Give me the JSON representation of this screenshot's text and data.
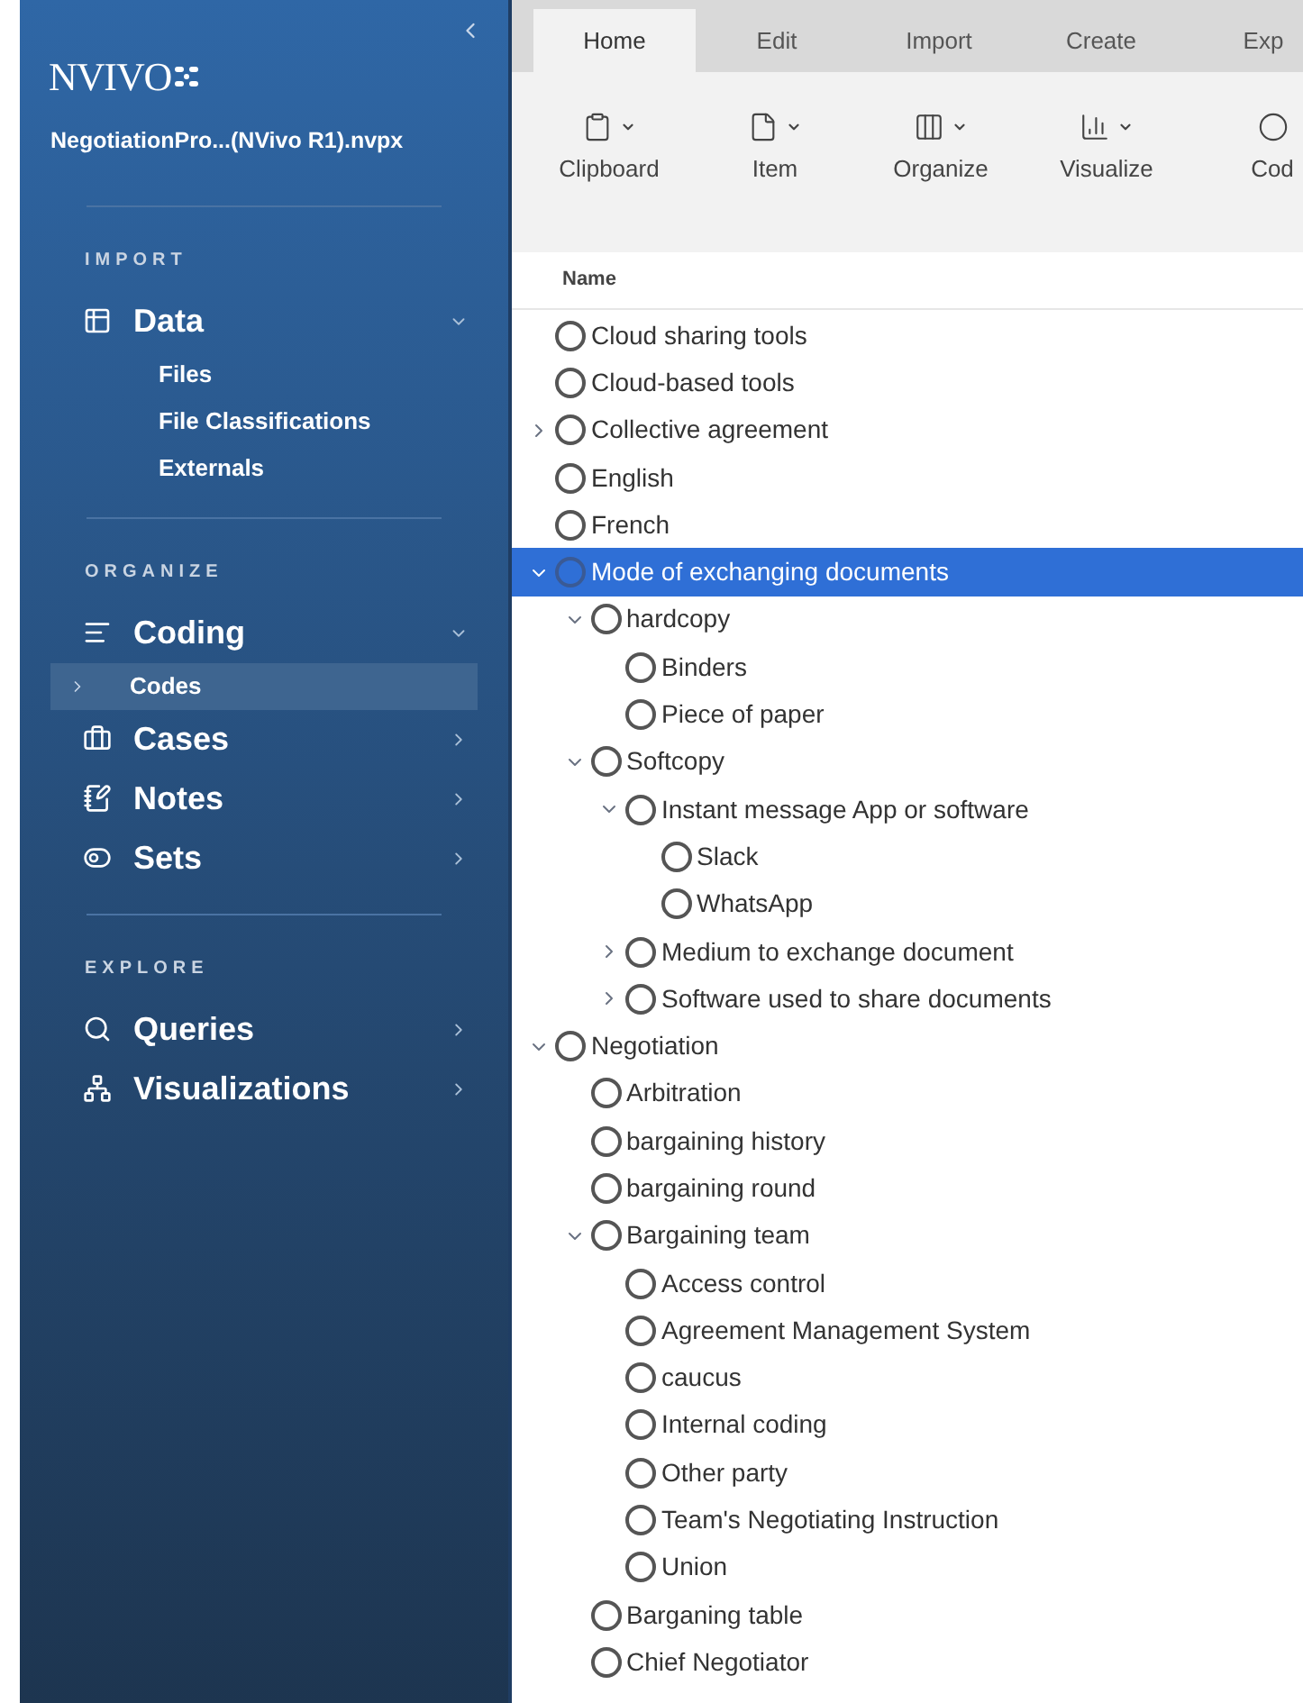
{
  "sidebar": {
    "logo": "NVIVO",
    "project": "NegotiationPro...(NVivo R1).nvpx",
    "sections": [
      {
        "title": "IMPORT",
        "items": [
          {
            "kind": "table",
            "label": "Data",
            "expanded": true,
            "children": [
              {
                "label": "Files",
                "selected": false
              },
              {
                "label": "File Classifications",
                "selected": false
              },
              {
                "label": "Externals",
                "selected": false
              }
            ]
          }
        ]
      },
      {
        "title": "ORGANIZE",
        "items": [
          {
            "kind": "lines",
            "label": "Coding",
            "expanded": true,
            "children": [
              {
                "label": "Codes",
                "selected": true
              }
            ]
          },
          {
            "kind": "briefcase",
            "label": "Cases",
            "expanded": false
          },
          {
            "kind": "notebook",
            "label": "Notes",
            "expanded": false
          },
          {
            "kind": "toggle",
            "label": "Sets",
            "expanded": false
          }
        ]
      },
      {
        "title": "EXPLORE",
        "items": [
          {
            "kind": "search",
            "label": "Queries",
            "expanded": false
          },
          {
            "kind": "network",
            "label": "Visualizations",
            "expanded": false
          }
        ]
      }
    ]
  },
  "ribbon": {
    "tabs": [
      {
        "label": "Home",
        "selected": true
      },
      {
        "label": "Edit",
        "selected": false
      },
      {
        "label": "Import",
        "selected": false
      },
      {
        "label": "Create",
        "selected": false
      },
      {
        "label": "Exp",
        "selected": false
      }
    ],
    "buttons": [
      {
        "kind": "clipboard",
        "label": "Clipboard"
      },
      {
        "kind": "document",
        "label": "Item"
      },
      {
        "kind": "organize",
        "label": "Organize"
      },
      {
        "kind": "chart",
        "label": "Visualize"
      },
      {
        "kind": "circle",
        "label": "Cod"
      }
    ]
  },
  "table": {
    "column": "Name",
    "rows": [
      {
        "label": "Cloud sharing tools",
        "selected": false
      },
      {
        "label": "Cloud-based tools",
        "selected": false
      },
      {
        "label": "Collective agreement",
        "selected": false,
        "expanded": false
      },
      {
        "label": "English",
        "selected": false
      },
      {
        "label": "French",
        "selected": false
      },
      {
        "label": "Mode of exchanging documents",
        "selected": true,
        "expanded": true,
        "children": [
          {
            "label": "hardcopy",
            "selected": false,
            "expanded": true,
            "children": [
              {
                "label": "Binders",
                "selected": false
              },
              {
                "label": "Piece of paper",
                "selected": false
              }
            ]
          },
          {
            "label": "Softcopy",
            "selected": false,
            "expanded": true,
            "children": [
              {
                "label": "Instant message App or software",
                "selected": false,
                "expanded": true,
                "children": [
                  {
                    "label": "Slack",
                    "selected": false
                  },
                  {
                    "label": "WhatsApp",
                    "selected": false
                  }
                ]
              },
              {
                "label": "Medium to exchange document",
                "selected": false,
                "expanded": false
              },
              {
                "label": "Software used to share documents",
                "selected": false,
                "expanded": false
              }
            ]
          }
        ]
      },
      {
        "label": "Negotiation",
        "selected": false,
        "expanded": true,
        "children": [
          {
            "label": "Arbitration",
            "selected": false
          },
          {
            "label": "bargaining history",
            "selected": false
          },
          {
            "label": "bargaining round",
            "selected": false
          },
          {
            "label": "Bargaining team",
            "selected": false,
            "expanded": true,
            "children": [
              {
                "label": "Access control",
                "selected": false
              },
              {
                "label": "Agreement Management System",
                "selected": false
              },
              {
                "label": "caucus",
                "selected": false
              },
              {
                "label": "Internal coding",
                "selected": false
              },
              {
                "label": "Other party",
                "selected": false
              },
              {
                "label": "Team's Negotiating Instruction",
                "selected": false
              },
              {
                "label": "Union",
                "selected": false
              }
            ]
          },
          {
            "label": "Barganing table",
            "selected": false
          },
          {
            "label": "Chief Negotiator",
            "selected": false
          }
        ]
      }
    ]
  }
}
